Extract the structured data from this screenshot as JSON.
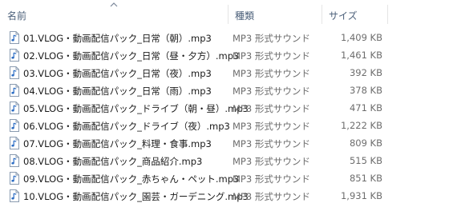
{
  "header": {
    "name_label": "名前",
    "type_label": "種類",
    "size_label": "サイズ",
    "sort_icon": "chevron-up-icon"
  },
  "files": [
    {
      "name": "01.VLOG・動画配信パック_日常（朝）.mp3",
      "type": "MP3 形式サウンド",
      "size": "1,409 KB"
    },
    {
      "name": "02.VLOG・動画配信パック_日常（昼・夕方）.mp3",
      "type": "MP3 形式サウンド",
      "size": "1,461 KB"
    },
    {
      "name": "03.VLOG・動画配信パック_日常（夜）.mp3",
      "type": "MP3 形式サウンド",
      "size": "392 KB"
    },
    {
      "name": "04.VLOG・動画配信パック_日常（雨）.mp3",
      "type": "MP3 形式サウンド",
      "size": "378 KB"
    },
    {
      "name": "05.VLOG・動画配信パック_ドライブ（朝・昼）.mp3",
      "type": "MP3 形式サウンド",
      "size": "471 KB"
    },
    {
      "name": "06.VLOG・動画配信パック_ドライブ（夜）.mp3",
      "type": "MP3 形式サウンド",
      "size": "1,222 KB"
    },
    {
      "name": "07.VLOG・動画配信パック_料理・食事.mp3",
      "type": "MP3 形式サウンド",
      "size": "809 KB"
    },
    {
      "name": "08.VLOG・動画配信パック_商品紹介.mp3",
      "type": "MP3 形式サウンド",
      "size": "515 KB"
    },
    {
      "name": "09.VLOG・動画配信パック_赤ちゃん・ペット.mp3",
      "type": "MP3 形式サウンド",
      "size": "851 KB"
    },
    {
      "name": "10.VLOG・動画配信パック_園芸・ガーデニング.mp3",
      "type": "MP3 形式サウンド",
      "size": "1,931 KB"
    }
  ],
  "icons": {
    "file": "audio-file-icon"
  },
  "colors": {
    "header_text": "#4c607a",
    "secondary_text": "#6d6d6d",
    "icon_blue": "#2b6cc4"
  }
}
